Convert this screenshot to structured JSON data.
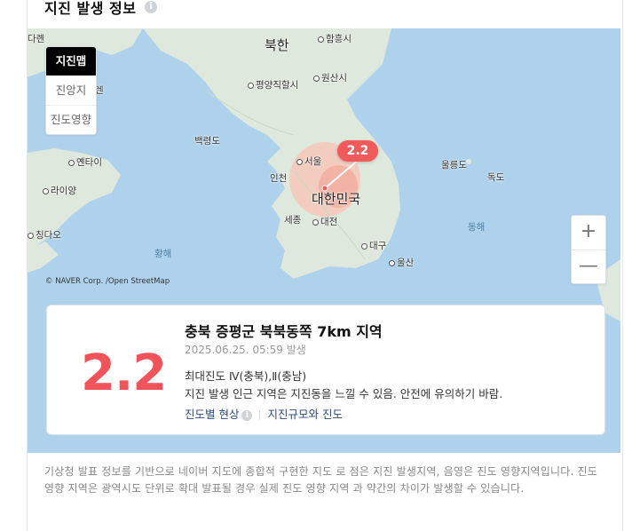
{
  "header": {
    "title": "지진 발생 정보"
  },
  "map": {
    "tabs": [
      {
        "label": "지진맵",
        "active": true
      },
      {
        "label": "진앙지",
        "active": false
      },
      {
        "label": "진도영향",
        "active": false
      }
    ],
    "labels": {
      "north_korea": "북한",
      "south_korea": "대한민국",
      "hamheung": "함흥시",
      "pyongyang": "평양직할시",
      "wonsan": "원산시",
      "baekryeong": "백령도",
      "seoul": "서울",
      "incheon": "인천",
      "sejong": "세종",
      "daejeon": "대전",
      "daegu": "대구",
      "ulsan": "울산",
      "ulleung": "울릉도",
      "dokdo": "독도",
      "yantai": "옌타이",
      "laiyang": "라이양",
      "qingdao": "칭다오",
      "yellow_sea": "황해",
      "east_sea": "동해",
      "dalian_edge": "다롄",
      "left_edge_2": "렌"
    },
    "marker_magnitude": "2.2",
    "copyright": "© NAVER Corp. /Open StreetMap",
    "zoom_in": "+",
    "zoom_out": "—"
  },
  "card": {
    "magnitude": "2.2",
    "location": "충북 증평군 북북동쪽 7km 지역",
    "time": "2025.06.25. 05:59 발생",
    "intensity": "최대진도 Ⅳ(충북),Ⅱ(충남)",
    "description": "지진 발생 인근 지역은 지진동을 느낄 수 있음. 안전에 유의하기 바람.",
    "link_intensity": "진도별 현상",
    "link_scale": "지진규모와 진도"
  },
  "footer": {
    "text": "기상청 발표 정보를 기반으로 네이버 지도에 종합적 구현한 지도 로 점은 지진 발생지역, 음영은 진도 영향지역입니다. 진도 영향 지역은 광역시도 단위로 확대 발표될 경우 실제 진도 영향 지역 과 약간의 차이가 발생할 수 있습니다."
  },
  "colors": {
    "accent": "#f0535a",
    "sea": "#aed2ec",
    "land": "#dfe8dc"
  }
}
